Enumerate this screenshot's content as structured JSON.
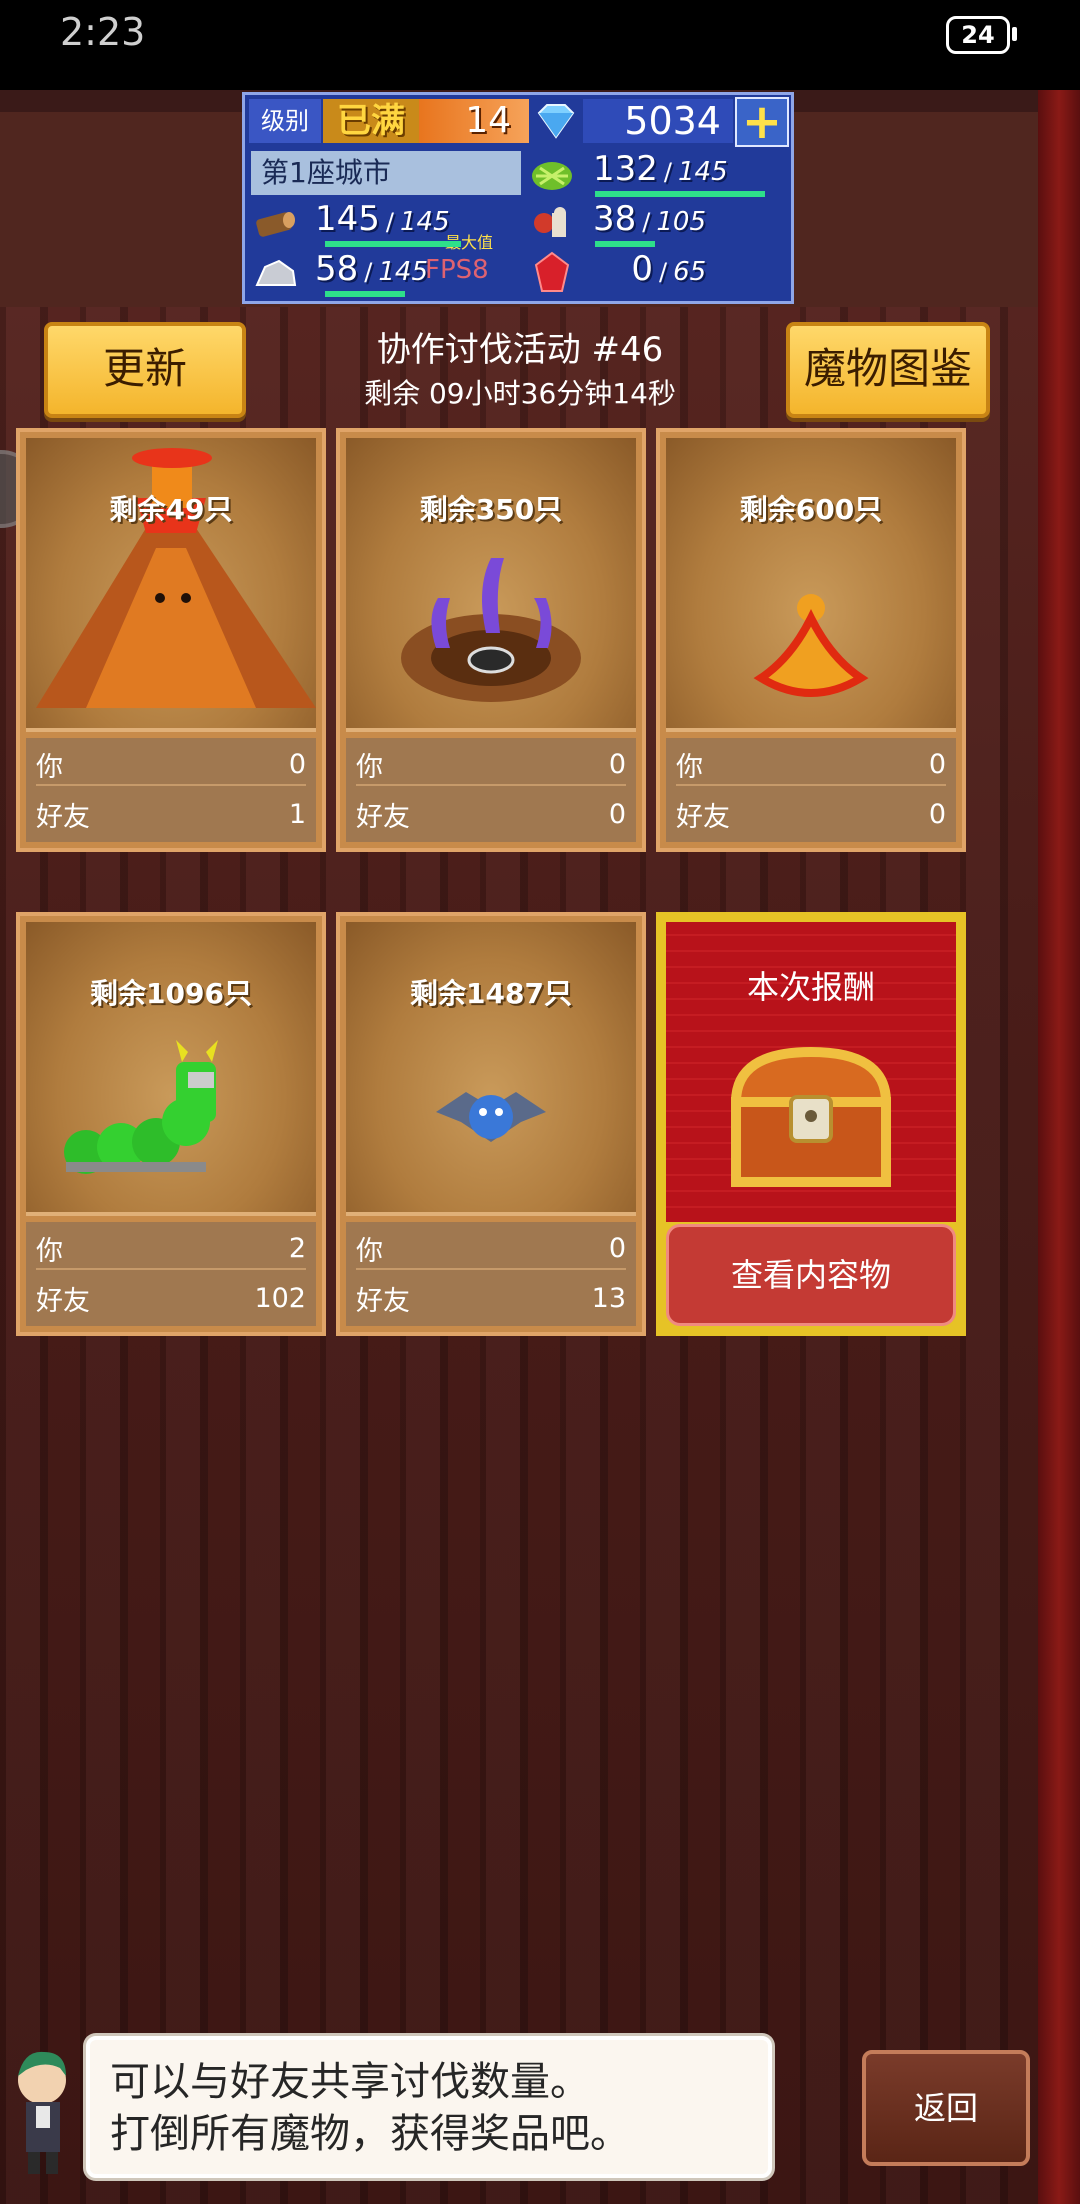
{
  "status": {
    "time": "2:23",
    "battery": "24"
  },
  "hud": {
    "level_label": "级别",
    "level_max": "已满",
    "level": "14",
    "gems": "5034",
    "plus": "+",
    "city": "第1座城市",
    "wood": {
      "value": "145",
      "max": "145",
      "note": "最大值"
    },
    "grass": {
      "value": "132",
      "max": "145"
    },
    "stone": {
      "value": "58",
      "max": "145"
    },
    "food": {
      "value": "38",
      "max": "105"
    },
    "ruby": {
      "value": "0",
      "max": "65"
    },
    "fps": "FPS8"
  },
  "header": {
    "refresh": "更新",
    "title": "协作讨伐活动 #46",
    "timer": "剩余 09小时36分钟14秒",
    "monster_book": "魔物图鉴"
  },
  "labels": {
    "you": "你",
    "friend": "好友"
  },
  "monsters": [
    {
      "remain": "剩余49只",
      "you": "0",
      "friend": "1",
      "icon": "volcano-monster"
    },
    {
      "remain": "剩余350只",
      "you": "0",
      "friend": "0",
      "icon": "pit-tentacle-monster"
    },
    {
      "remain": "剩余600只",
      "you": "0",
      "friend": "0",
      "icon": "fire-slime-monster"
    },
    {
      "remain": "剩余1096只",
      "you": "2",
      "friend": "102",
      "icon": "caterpillar-monster"
    },
    {
      "remain": "剩余1487只",
      "you": "0",
      "friend": "13",
      "icon": "bat-monster"
    }
  ],
  "reward": {
    "title": "本次报酬",
    "button": "查看内容物"
  },
  "speech": {
    "line1": "可以与好友共享讨伐数量。",
    "line2": "打倒所有魔物，获得奖品吧。"
  },
  "back": "返回",
  "colors": {
    "accent_yellow": "#f4b52c",
    "reward_red": "#b8121a",
    "card_tan": "#c88b4a",
    "hud_blue": "#213a9a"
  }
}
